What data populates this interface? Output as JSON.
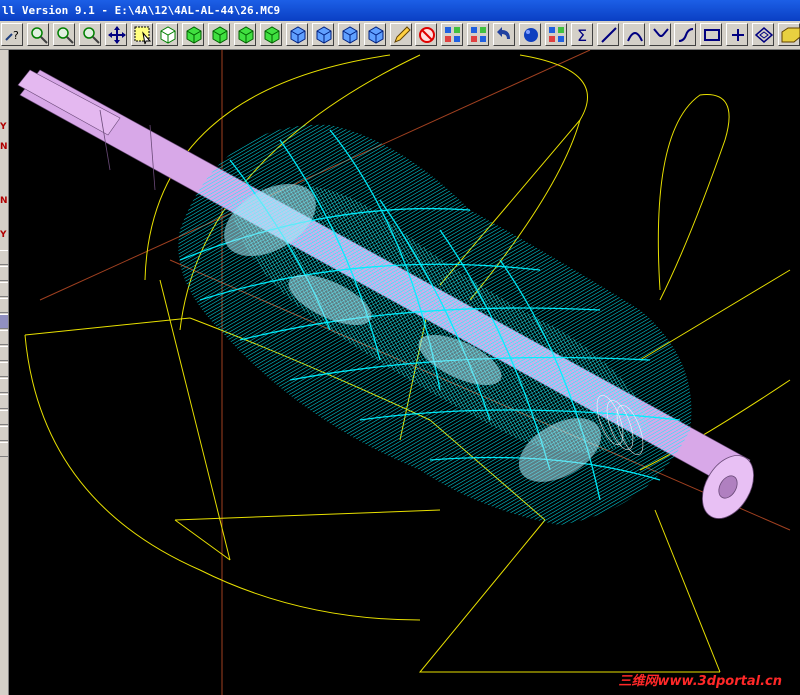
{
  "window": {
    "title": "ll Version 9.1 - E:\\4A\\12\\4AL-AL-44\\26.MC9"
  },
  "toolbar": {
    "buttons": [
      {
        "name": "help-icon",
        "icon": "help"
      },
      {
        "name": "zoom-window-icon",
        "icon": "zoom"
      },
      {
        "name": "zoom-in-icon",
        "icon": "zoom"
      },
      {
        "name": "zoom-fit-icon",
        "icon": "zoom"
      },
      {
        "name": "pan-icon",
        "icon": "pan"
      },
      {
        "name": "select-window-icon",
        "icon": "select"
      },
      {
        "name": "view-iso-icon",
        "icon": "cube"
      },
      {
        "name": "view-front-icon",
        "icon": "cube-green"
      },
      {
        "name": "view-top-icon",
        "icon": "cube-green"
      },
      {
        "name": "view-side-icon",
        "icon": "cube-green"
      },
      {
        "name": "view-right-icon",
        "icon": "cube-green"
      },
      {
        "name": "view-back-icon",
        "icon": "cube-blue"
      },
      {
        "name": "view-bottom-icon",
        "icon": "cube-blue"
      },
      {
        "name": "view-left-icon",
        "icon": "cube-blue"
      },
      {
        "name": "view-custom-icon",
        "icon": "cube-blue"
      },
      {
        "name": "pencil-icon",
        "icon": "pencil"
      },
      {
        "name": "delete-icon",
        "icon": "delete"
      },
      {
        "name": "transform-icon",
        "icon": "grid"
      },
      {
        "name": "transform2-icon",
        "icon": "grid"
      },
      {
        "name": "undo-icon",
        "icon": "undo"
      },
      {
        "name": "shade-icon",
        "icon": "sphere"
      },
      {
        "name": "grid-icon",
        "icon": "grid"
      },
      {
        "name": "sigma-icon",
        "icon": "sigma"
      },
      {
        "name": "line-icon",
        "icon": "line"
      },
      {
        "name": "arc-icon",
        "icon": "arc"
      },
      {
        "name": "fillet-icon",
        "icon": "fillet"
      },
      {
        "name": "spline-icon",
        "icon": "spline"
      },
      {
        "name": "rectangle-icon",
        "icon": "rect"
      },
      {
        "name": "point-icon",
        "icon": "plus"
      },
      {
        "name": "plane-icon",
        "icon": "plane"
      },
      {
        "name": "box-icon",
        "icon": "box"
      }
    ]
  },
  "side": {
    "letters": [
      "Y",
      "N",
      "N",
      "Y"
    ]
  },
  "watermark": {
    "text": "三维网www.3dportal.cn"
  },
  "colors": {
    "toolpath": "#00f0ff",
    "shaft": "#d8a8e8",
    "wireframe": "#e8e000",
    "axis": "#a04020",
    "background": "#000000"
  }
}
